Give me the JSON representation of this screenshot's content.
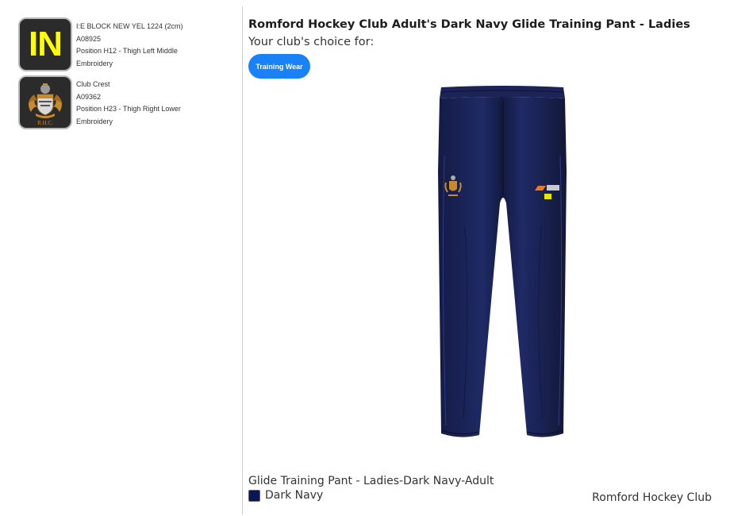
{
  "embroidery": [
    {
      "thumb_text": "IN",
      "thumb_text_color": "#ffff00",
      "name": "I:E BLOCK NEW YEL 1224 (2cm)",
      "code": "A08925",
      "position": "Position H12 - Thigh Left Middle",
      "method": "Embroidery"
    },
    {
      "thumb_icon": "club-crest-icon",
      "crest_letters": "R.H.C.",
      "name": "Club Crest",
      "code": "A09362",
      "position": "Position H23 - Thigh Right Lower",
      "method": "Embroidery"
    }
  ],
  "product": {
    "title": "Romford Hockey Club Adult's Dark Navy Glide Training Pant - Ladies",
    "choice_label": "Your club's choice for:",
    "tag_label": "Training Wear",
    "tag_color": "#1a82f7",
    "image_icon": "training-pant-image",
    "variant_name": "Glide Training Pant - Ladies-Dark Navy-Adult",
    "colour_name": "Dark Navy",
    "colour_hex": "#0d1654",
    "club_name": "Romford Hockey Club"
  }
}
